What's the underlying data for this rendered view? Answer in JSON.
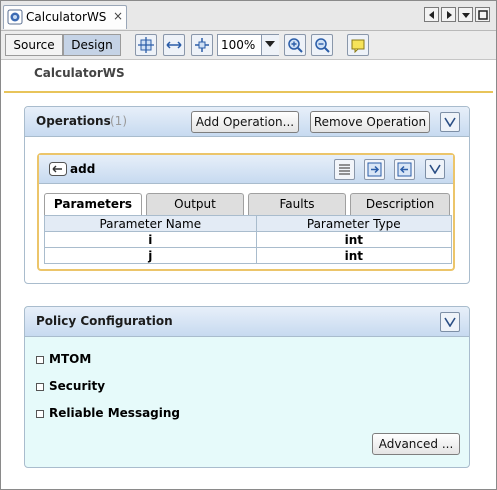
{
  "window": {
    "tab_title": "CalculatorWS",
    "tab_close": "×",
    "tab_icon": "web-service-icon",
    "nav_buttons": [
      "scroll-left-icon",
      "scroll-right-icon",
      "tab-menu-icon",
      "maximize-icon"
    ]
  },
  "toolbar": {
    "source_label": "Source",
    "design_label": "Design",
    "zoom_value": "100%",
    "icons": [
      "fit-page-icon",
      "fit-width-icon",
      "actual-size-icon",
      "zoom-in-icon",
      "zoom-out-icon",
      "add-note-icon"
    ]
  },
  "header": {
    "title": "CalculatorWS"
  },
  "operations": {
    "title": "Operations",
    "count": "(1)",
    "add_button": "Add Operation...",
    "remove_button": "Remove Operation",
    "operation": {
      "name": "add",
      "tabs": [
        "Parameters",
        "Output",
        "Faults",
        "Description"
      ],
      "active_tab": "Parameters",
      "columns": [
        "Parameter Name",
        "Parameter Type"
      ],
      "rows": [
        [
          "i",
          "int"
        ],
        [
          "j",
          "int"
        ]
      ]
    }
  },
  "policy": {
    "title": "Policy Configuration",
    "options": [
      "MTOM",
      "Security",
      "Reliable Messaging"
    ],
    "advanced_button": "Advanced ..."
  },
  "colors": {
    "accent_gold": "#e8c45a",
    "panel_header": "#c7daf0",
    "policy_bg": "#e6fafa"
  }
}
